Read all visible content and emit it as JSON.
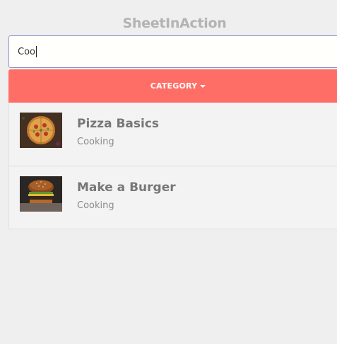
{
  "app": {
    "title": "SheetInAction"
  },
  "search": {
    "value": "Coo"
  },
  "category_button": {
    "label": "CATEGORY"
  },
  "items": [
    {
      "title": "Pizza Basics",
      "category": "Cooking",
      "image": "pizza-image"
    },
    {
      "title": "Make a Burger",
      "category": "Cooking",
      "image": "burger-image"
    }
  ],
  "colors": {
    "accent": "#ff6e66",
    "title": "#b3b3b3",
    "search_border": "#8d8fd0",
    "background": "#efefef"
  }
}
